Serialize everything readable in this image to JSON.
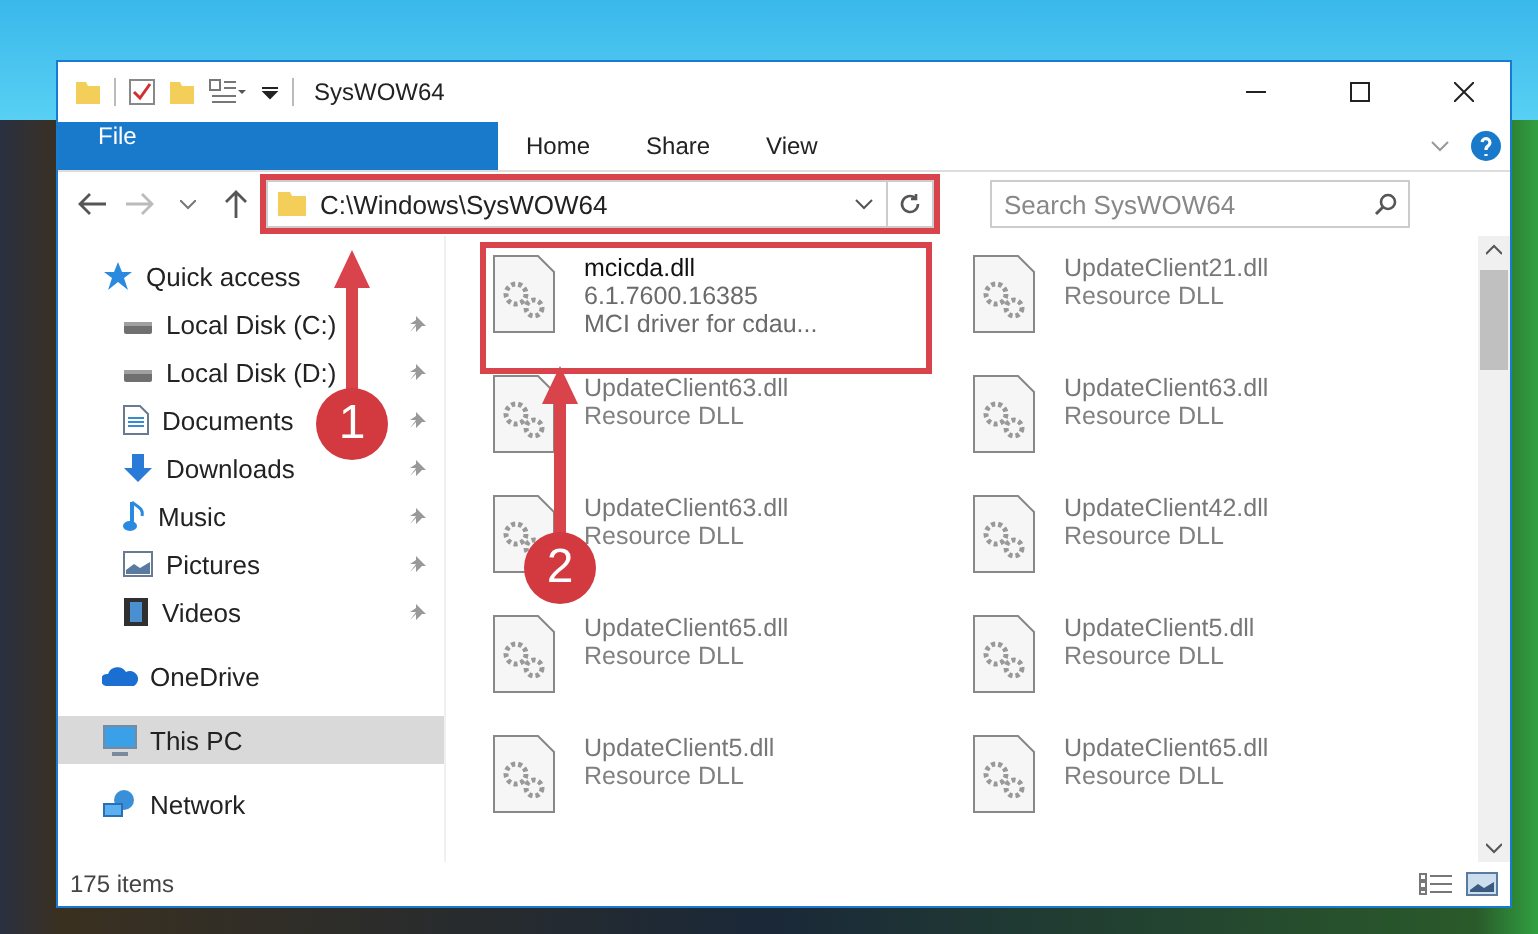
{
  "window": {
    "title": "SysWOW64"
  },
  "ribbon_tabs": [
    {
      "label": "File",
      "kind": "file"
    },
    {
      "label": "Home",
      "kind": "tab"
    },
    {
      "label": "Share",
      "kind": "tab"
    },
    {
      "label": "View",
      "kind": "tab"
    }
  ],
  "address": {
    "path": "C:\\Windows\\SysWOW64",
    "highlighted": true
  },
  "search": {
    "placeholder": "Search SysWOW64"
  },
  "nav": [
    {
      "label": "Quick access",
      "kind": "star",
      "selected": false,
      "children": [
        {
          "label": "Local Disk (C:)",
          "kind": "disk",
          "pinned": true,
          "selected": false
        },
        {
          "label": "Local Disk (D:)",
          "kind": "disk",
          "pinned": true,
          "selected": false
        },
        {
          "label": "Documents",
          "kind": "document",
          "pinned": true,
          "selected": false
        },
        {
          "label": "Downloads",
          "kind": "download",
          "pinned": true,
          "selected": false
        },
        {
          "label": "Music",
          "kind": "music",
          "pinned": true,
          "selected": false
        },
        {
          "label": "Pictures",
          "kind": "picture",
          "pinned": true,
          "selected": false
        },
        {
          "label": "Videos",
          "kind": "video",
          "pinned": true,
          "selected": false
        }
      ]
    },
    {
      "label": "OneDrive",
      "kind": "cloud",
      "selected": false
    },
    {
      "label": "This PC",
      "kind": "monitor",
      "selected": true
    },
    {
      "label": "Network",
      "kind": "network",
      "selected": false
    }
  ],
  "files": [
    {
      "name": "mcicda.dll",
      "lines": [
        "6.1.7600.16385",
        "MCI driver for cdau..."
      ],
      "blurred": false,
      "highlighted": true
    },
    {
      "name": "UpdateClient21.dll",
      "lines": [
        "Resource DLL"
      ],
      "blurred": true,
      "highlighted": false
    },
    {
      "name": "UpdateClient63.dll",
      "lines": [
        "Resource DLL"
      ],
      "blurred": true,
      "highlighted": false
    },
    {
      "name": "UpdateClient63.dll",
      "lines": [
        "Resource DLL"
      ],
      "blurred": true,
      "highlighted": false
    },
    {
      "name": "UpdateClient63.dll",
      "lines": [
        "Resource DLL"
      ],
      "blurred": true,
      "highlighted": false
    },
    {
      "name": "UpdateClient42.dll",
      "lines": [
        "Resource DLL"
      ],
      "blurred": true,
      "highlighted": false
    },
    {
      "name": "UpdateClient65.dll",
      "lines": [
        "Resource DLL"
      ],
      "blurred": true,
      "highlighted": false
    },
    {
      "name": "UpdateClient5.dll",
      "lines": [
        "Resource DLL"
      ],
      "blurred": true,
      "highlighted": false
    },
    {
      "name": "UpdateClient5.dll",
      "lines": [
        "Resource DLL"
      ],
      "blurred": true,
      "highlighted": false
    },
    {
      "name": "UpdateClient65.dll",
      "lines": [
        "Resource DLL"
      ],
      "blurred": true,
      "highlighted": false
    }
  ],
  "status_bar": {
    "count": "175 items"
  },
  "callouts": [
    {
      "number": "1"
    },
    {
      "number": "2"
    }
  ]
}
